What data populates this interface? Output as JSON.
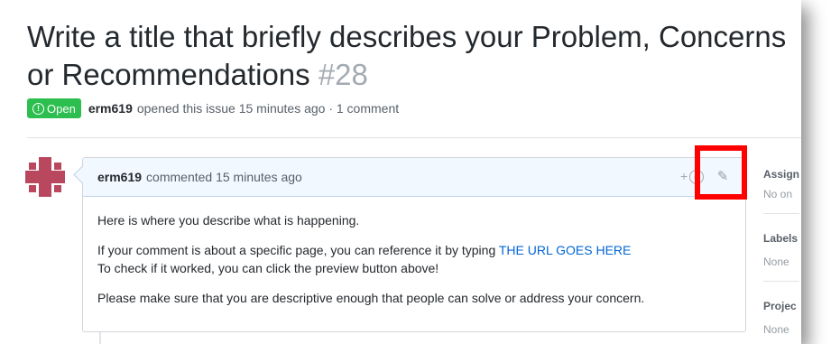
{
  "issue": {
    "title": "Write a title that briefly describes your Problem, Concerns or Recommendations",
    "number": "#28",
    "state_label": "Open",
    "author": "erm619",
    "meta_text": "opened this issue 15 minutes ago · 1 comment"
  },
  "comment": {
    "author": "erm619",
    "header_text": "commented 15 minutes ago",
    "reaction_plus": "+",
    "body": {
      "line1": "Here is where you describe what is happening.",
      "line2_prefix": "If your comment is about a specific page, you can reference it by typing ",
      "line2_link": "THE URL GOES HERE",
      "line3": "To check if it worked, you can click the preview button above!",
      "line4": "Please make sure that you are descriptive enough that people can solve or address your concern."
    }
  },
  "sidebar": {
    "assignees_label": "Assign",
    "assignees_value": "No on",
    "labels_label": "Labels",
    "labels_value": "None",
    "projects_label": "Projec",
    "projects_value": "None"
  },
  "colors": {
    "open_badge": "#2cbe4e",
    "link": "#0366d6",
    "highlight": "#ff0000",
    "comment_header_bg": "#f1f8ff"
  },
  "icons": [
    "issue-opened-icon",
    "smiley-icon",
    "pencil-icon"
  ]
}
